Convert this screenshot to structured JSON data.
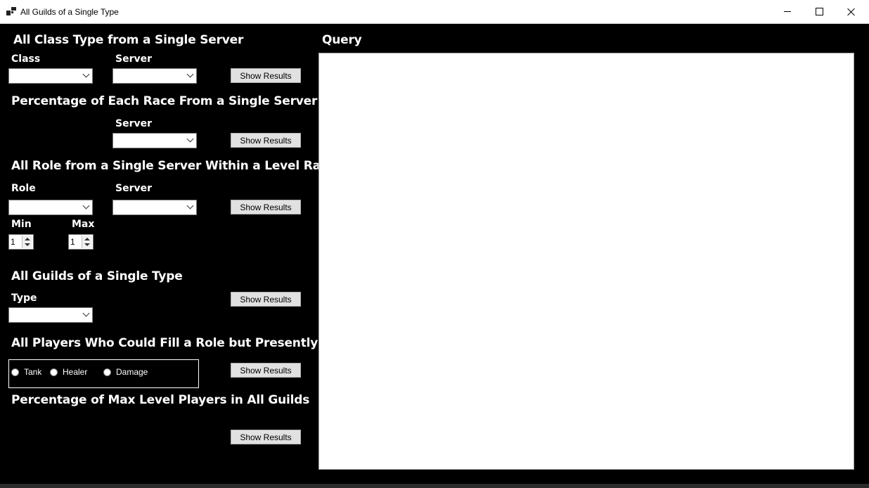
{
  "window": {
    "title": "All Guilds of a Single Type"
  },
  "section_class": {
    "heading": "All Class Type from a Single Server",
    "class_label": "Class",
    "server_label": "Server",
    "class_value": "",
    "server_value": "",
    "button": "Show Results"
  },
  "section_race": {
    "heading": "Percentage of Each Race From a Single Server",
    "server_label": "Server",
    "server_value": "",
    "button": "Show Results"
  },
  "section_role": {
    "heading": "All Role from a Single Server Within a Level Range",
    "role_label": "Role",
    "server_label": "Server",
    "role_value": "",
    "server_value": "",
    "min_label": "Min",
    "max_label": "Max",
    "min_value": "1",
    "max_value": "1",
    "button": "Show Results"
  },
  "section_guilds": {
    "heading": "All Guilds of a Single Type",
    "type_label": "Type",
    "type_value": "",
    "button": "Show Results"
  },
  "section_fill_role": {
    "heading": "All Players Who Could Fill a Role but Presently Aren't",
    "options": [
      "Tank",
      "Healer",
      "Damage"
    ],
    "button": "Show Results"
  },
  "section_max_level": {
    "heading": "Percentage of Max Level Players in All Guilds",
    "button": "Show Results"
  },
  "query": {
    "heading": "Query"
  }
}
